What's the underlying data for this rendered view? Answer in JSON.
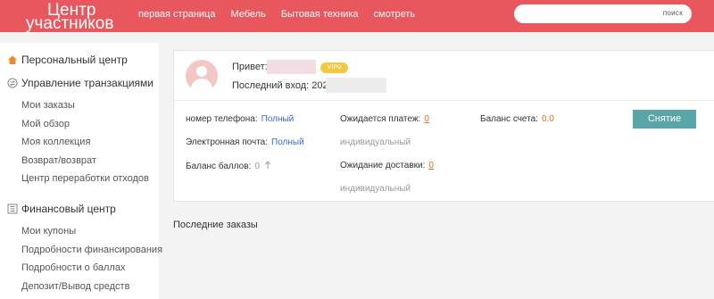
{
  "header": {
    "logo_line1": "Центр",
    "logo_line2": "участников",
    "nav": [
      "первая страница",
      "Мебель",
      "Бытовая техника",
      "смотреть"
    ],
    "search": {
      "placeholder": "",
      "button": "поиск"
    }
  },
  "sidebar": {
    "sections": [
      {
        "title": "Персональный центр",
        "icon": "home-icon",
        "items": []
      },
      {
        "title": "Управление транзакциями",
        "icon": "transactions-icon",
        "items": [
          "Мои заказы",
          "Мой обзор",
          "Моя коллекция",
          "Возврат/возврат",
          "Центр переработки отходов"
        ]
      },
      {
        "title": "Финансовый центр",
        "icon": "finance-icon",
        "items": [
          "Мои купоны",
          "Подробности финансирования",
          "Подробности о баллах",
          "Депозит/Вывод средств"
        ]
      }
    ]
  },
  "profile": {
    "greeting": "Привет:",
    "vip": "VIP0",
    "last_login_label": "Последний вход:",
    "last_login_value": "2026"
  },
  "account": {
    "phone_label": "номер телефона:",
    "phone_value": "Полный",
    "email_label": "Электронная почта:",
    "email_value": "Полный",
    "points_label": "Баланс баллов:",
    "points_value": "0",
    "pending_payment_label": "Ожидается платеж:",
    "pending_payment_value": "0",
    "pending_payment_sub": "индивидуальный",
    "pending_delivery_label": "Ожидание доставки:",
    "pending_delivery_value": "0",
    "pending_delivery_sub": "индивидуальный",
    "balance_label": "Баланс счета:",
    "balance_value": "0.0",
    "withdraw_button": "Снятие"
  },
  "recent_orders_title": "Последние заказы",
  "colors": {
    "header": "#e8575d",
    "accent_teal": "#5aa5a8",
    "link_blue": "#3a6ec2",
    "orange": "#e86b1f",
    "vip": "#f5c842"
  }
}
